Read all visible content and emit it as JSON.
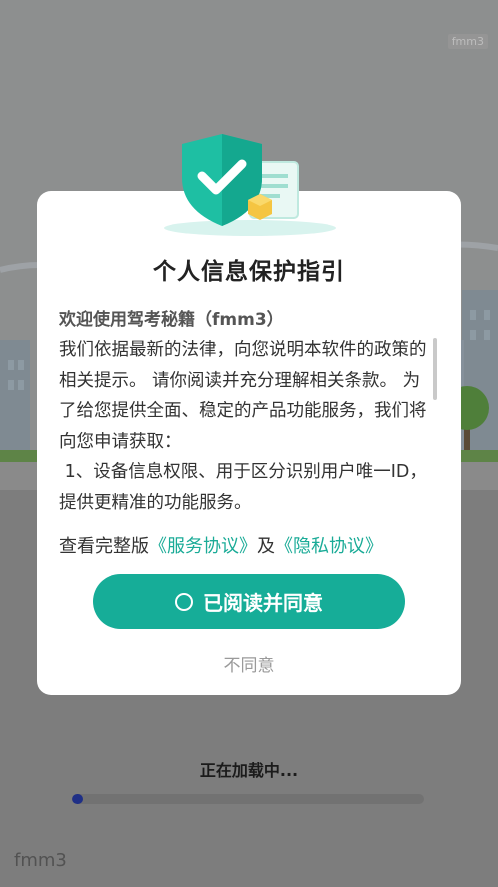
{
  "splash": {
    "corner_tag": "fmm3",
    "loading_text": "正在加载中...",
    "progress": 0.03,
    "footer_brand": "fmm3"
  },
  "dialog": {
    "title": "个人信息保护指引",
    "welcome": "欢迎使用驾考秘籍（fmm3）",
    "content": "我们依据最新的法律，向您说明本软件的政策的相关提示。 请你阅读并充分理解相关条款。 为了给您提供全面、稳定的产品功能服务，我们将向您申请获取：\n 1、设备信息权限、用于区分识别用户唯一ID，提供更精准的功能服务。",
    "links_prefix": "查看完整版",
    "service_link": "《服务协议》",
    "links_and": "及",
    "privacy_link": "《隐私协议》",
    "agree_button": "已阅读并同意",
    "disagree_button": "不同意"
  },
  "colors": {
    "accent": "#16ad98",
    "link": "#1aab97",
    "progress": "#1f2f86"
  }
}
